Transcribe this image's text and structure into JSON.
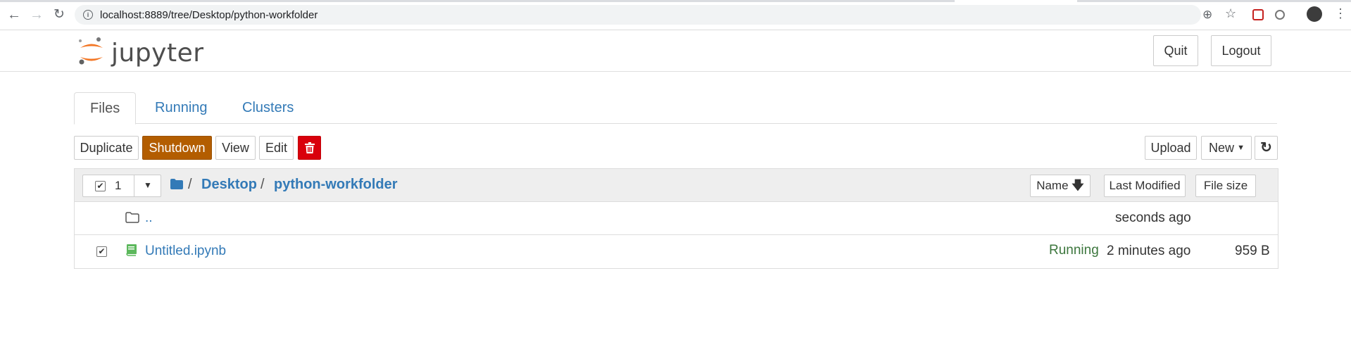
{
  "browser": {
    "url": "localhost:8889/tree/Desktop/python-workfolder",
    "back_icon": "arrow-left-icon",
    "forward_icon": "arrow-right-icon",
    "reload_icon": "reload-icon"
  },
  "header": {
    "logo_text": "jupyter",
    "quit_label": "Quit",
    "logout_label": "Logout"
  },
  "tabs": [
    {
      "label": "Files",
      "active": true
    },
    {
      "label": "Running",
      "active": false
    },
    {
      "label": "Clusters",
      "active": false
    }
  ],
  "toolbar": {
    "duplicate_label": "Duplicate",
    "shutdown_label": "Shutdown",
    "view_label": "View",
    "edit_label": "Edit",
    "upload_label": "Upload",
    "new_label": "New"
  },
  "list_header": {
    "selected_count": "1",
    "breadcrumb_sep": "/",
    "breadcrumb": [
      "Desktop",
      "python-workfolder"
    ],
    "sort_name_label": "Name",
    "sort_modified_label": "Last Modified",
    "sort_size_label": "File size"
  },
  "rows": [
    {
      "name": "..",
      "type": "folder",
      "status": "",
      "modified": "seconds ago",
      "size": "",
      "checked": false
    },
    {
      "name": "Untitled.ipynb",
      "type": "notebook",
      "status": "Running",
      "modified": "2 minutes ago",
      "size": "959 B",
      "checked": true
    }
  ],
  "colors": {
    "link": "#337ab7",
    "running": "#5cb85c",
    "shutdown": "#b35d00",
    "delete": "#d9000c"
  }
}
